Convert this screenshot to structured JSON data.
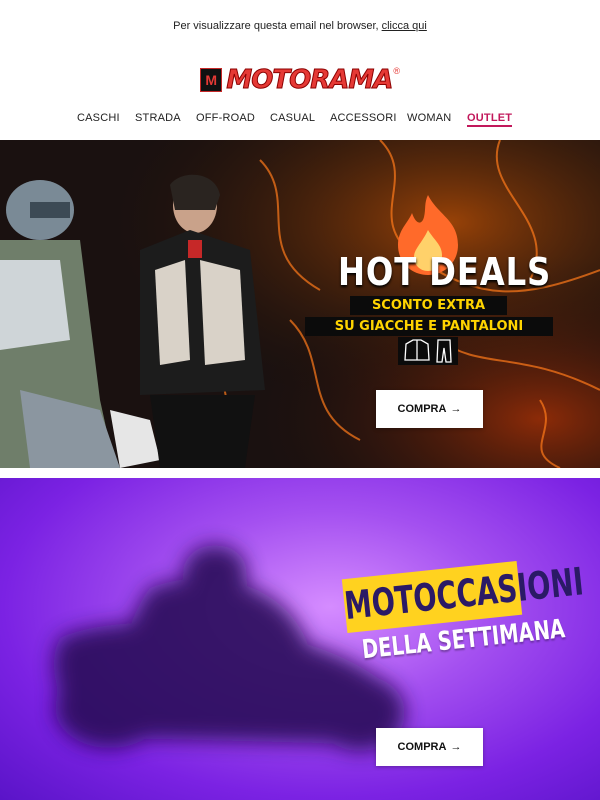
{
  "preheader": {
    "text": "Per visualizzare questa email nel browser, ",
    "link": "clicca qui"
  },
  "brand": {
    "name": "MOTORAMA",
    "mark": "M",
    "registered": "®",
    "color": "#e53935"
  },
  "nav": {
    "items": [
      "CASCHI",
      "STRADA",
      "OFF-ROAD",
      "CASUAL",
      "ACCESSORI",
      "WOMAN",
      "OUTLET"
    ],
    "active": "OUTLET",
    "active_color": "#c2185b"
  },
  "hero_hot_deals": {
    "title": "HOT DEALS",
    "subtitle_line1": "SCONTO EXTRA",
    "subtitle_line2": "SU GIACCHE E PANTALONI",
    "cta_label": "COMPRA",
    "cta_icon": "arrow-right-icon",
    "accent_color": "#ffd400",
    "icons": [
      "flame-icon",
      "jacket-icon",
      "pants-icon"
    ]
  },
  "hero_motoccasioni": {
    "title": "MOTOCCASIONI",
    "subtitle": "DELLA SETTIMANA",
    "cta_label": "COMPRA",
    "cta_icon": "arrow-right-icon",
    "accent_color": "#ffd21f",
    "background_color": "#8a2be2"
  }
}
